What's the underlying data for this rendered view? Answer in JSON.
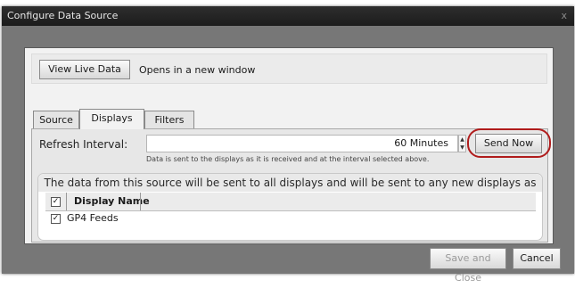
{
  "window": {
    "title": "Configure Data Source",
    "close_glyph": "x"
  },
  "top_strip": {
    "view_live_label": "View Live Data",
    "view_live_note": "Opens in a new window"
  },
  "tabs": [
    {
      "label": "Source",
      "active": false
    },
    {
      "label": "Displays",
      "active": true
    },
    {
      "label": "Filters",
      "active": false
    }
  ],
  "refresh": {
    "label": "Refresh Interval:",
    "value": "60 Minutes",
    "send_now_label": "Send Now",
    "hint": "Data is sent to the displays as it is received and at the interval selected above."
  },
  "displays": {
    "info": "The data from this source will be sent to all displays and will be sent to any new displays as they are added.",
    "header_checked": true,
    "column_header": "Display Name",
    "rows": [
      {
        "name": "GP4 Feeds",
        "checked": true
      }
    ]
  },
  "footer": {
    "save_close_label": "Save and Close",
    "cancel_label": "Cancel"
  },
  "colors": {
    "titlebar": "#1c1c1c",
    "dialog_body": "#777777",
    "highlight_ring": "#b01c1c"
  }
}
